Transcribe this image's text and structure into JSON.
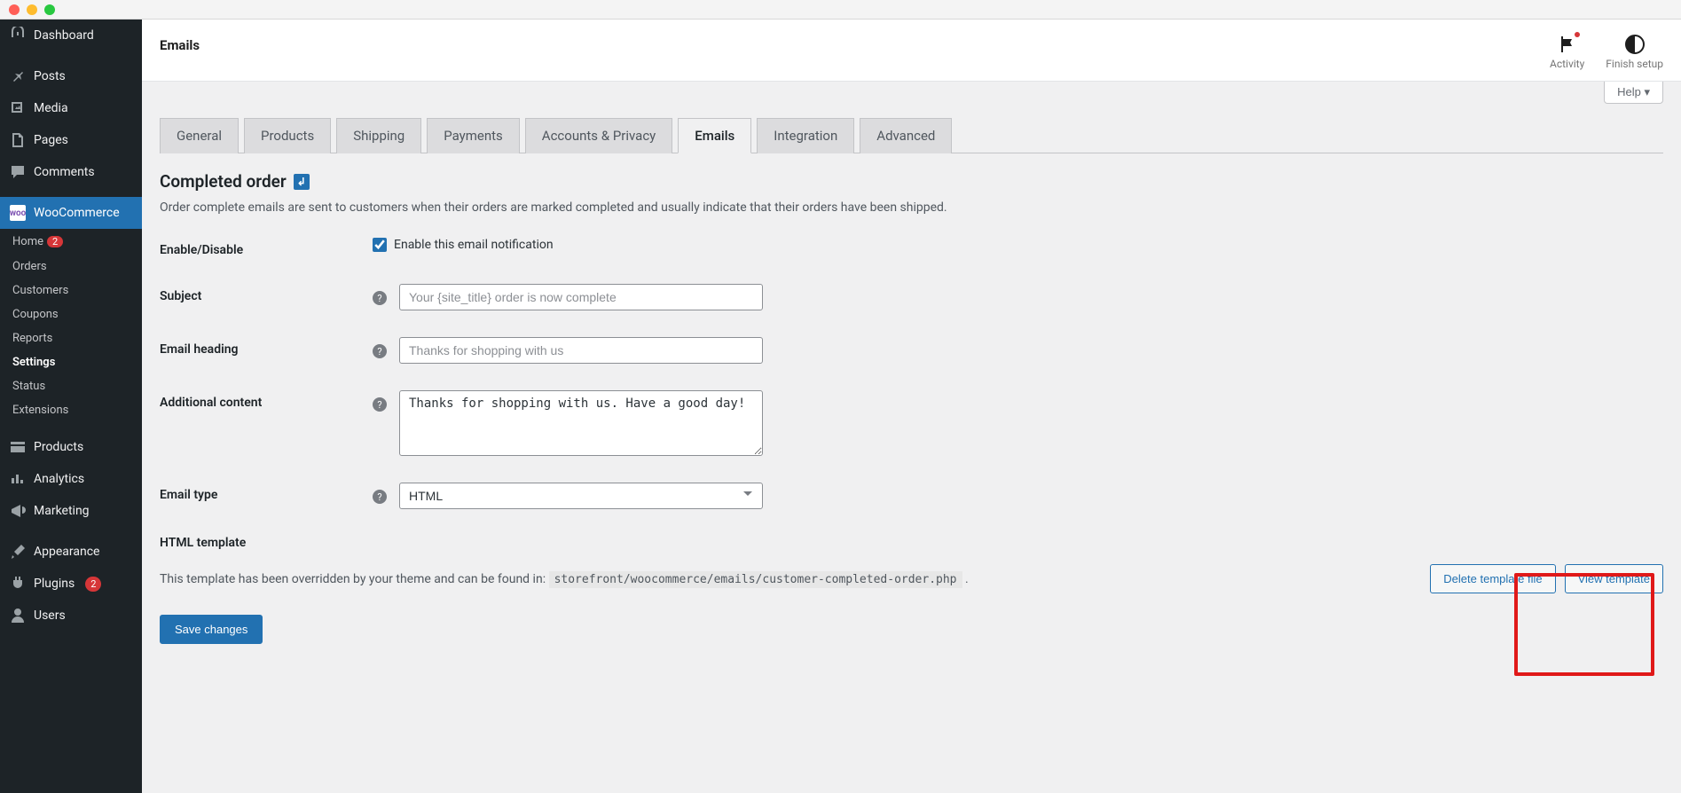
{
  "header": {
    "title": "Emails",
    "activity": "Activity",
    "finish": "Finish setup",
    "help": "Help ▾"
  },
  "sidebar": {
    "dash": "Dashboard",
    "posts": "Posts",
    "media": "Media",
    "pages": "Pages",
    "comments": "Comments",
    "woo": "WooCommerce",
    "sub": {
      "home": "Home",
      "home_badge": "2",
      "orders": "Orders",
      "customers": "Customers",
      "coupons": "Coupons",
      "reports": "Reports",
      "settings": "Settings",
      "status": "Status",
      "extensions": "Extensions"
    },
    "products": "Products",
    "analytics": "Analytics",
    "marketing": "Marketing",
    "appearance": "Appearance",
    "plugins": "Plugins",
    "plugins_badge": "2",
    "users": "Users"
  },
  "tabs": [
    "General",
    "Products",
    "Shipping",
    "Payments",
    "Accounts & Privacy",
    "Emails",
    "Integration",
    "Advanced"
  ],
  "active_tab": "Emails",
  "section": {
    "title": "Completed order",
    "desc": "Order complete emails are sent to customers when their orders are marked completed and usually indicate that their orders have been shipped."
  },
  "fields": {
    "enable_label": "Enable/Disable",
    "enable_checkbox_label": "Enable this email notification",
    "enable_checked": true,
    "subject_label": "Subject",
    "subject_placeholder": "Your {site_title} order is now complete",
    "heading_label": "Email heading",
    "heading_placeholder": "Thanks for shopping with us",
    "additional_label": "Additional content",
    "additional_value": "Thanks for shopping with us. Have a good day!",
    "type_label": "Email type",
    "type_value": "HTML"
  },
  "template": {
    "heading": "HTML template",
    "text_prefix": "This template has been overridden by your theme and can be found in: ",
    "path": "storefront/woocommerce/emails/customer-completed-order.php",
    "delete": "Delete template file",
    "view": "View template"
  },
  "save": "Save changes"
}
